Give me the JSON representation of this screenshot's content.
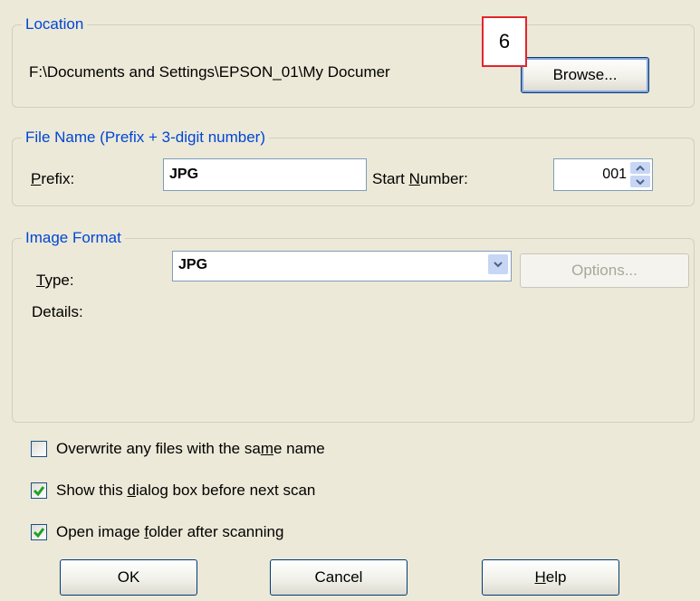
{
  "location": {
    "legend": "Location",
    "path": "F:\\Documents and Settings\\EPSON_01\\My Documer",
    "browse_label": "Browse..."
  },
  "annotation": {
    "label": "6"
  },
  "file_name": {
    "legend": "File Name (Prefix + 3-digit number)",
    "prefix_label": "Prefix:",
    "prefix_value": "JPG",
    "start_number_label": "Start Number:",
    "start_number_value": "001"
  },
  "image_format": {
    "legend": "Image Format",
    "type_label": "Type:",
    "type_value": "JPG",
    "options_label": "Options...",
    "details_label": "Details:"
  },
  "checkboxes": [
    {
      "label": "Overwrite any files with the same name",
      "checked": false
    },
    {
      "label": "Show this dialog box before next scan",
      "checked": true
    },
    {
      "label": "Open image folder after scanning",
      "checked": true
    }
  ],
  "buttons": {
    "ok": "OK",
    "cancel": "Cancel",
    "help": "Help"
  },
  "colors": {
    "legend": "#0046d5",
    "check": "#21a121",
    "annotation_border": "#e3262b"
  }
}
